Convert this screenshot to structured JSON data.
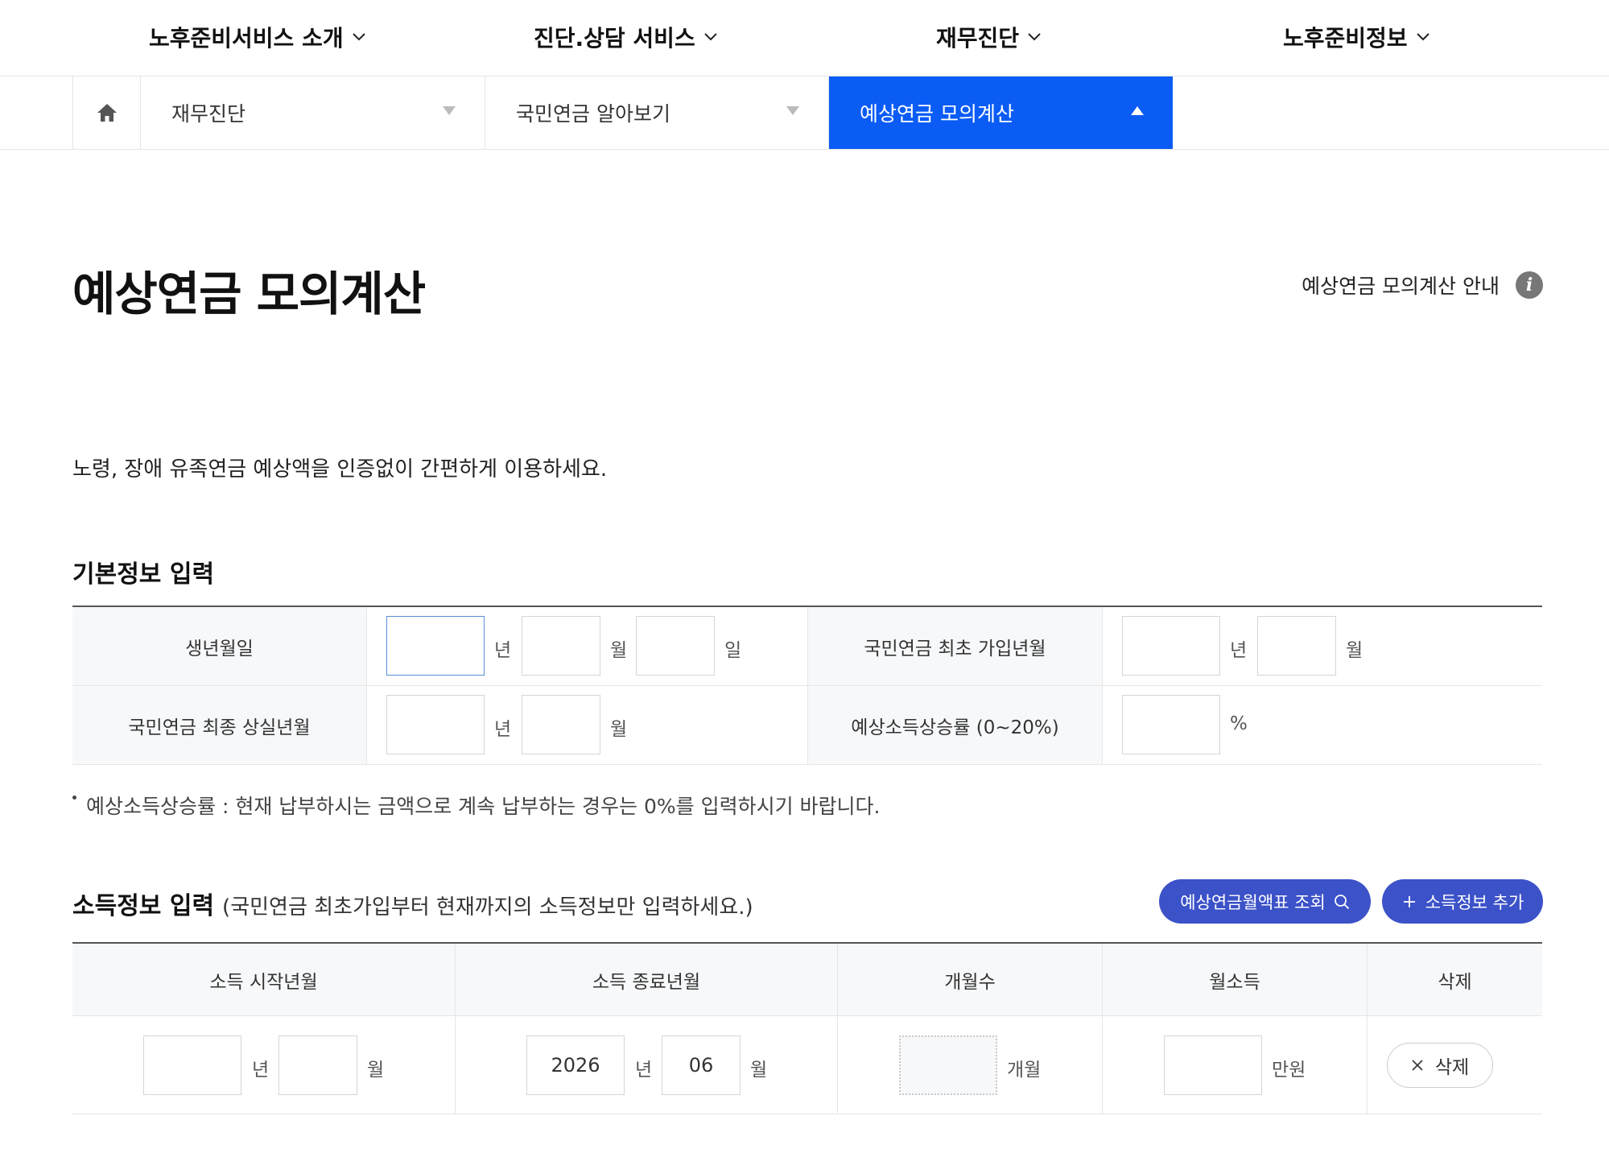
{
  "gnb": {
    "items": [
      {
        "label": "노후준비서비스 소개"
      },
      {
        "label": "진단.상담 서비스"
      },
      {
        "label": "재무진단"
      },
      {
        "label": "노후준비정보"
      }
    ]
  },
  "breadcrumb": {
    "level1": "재무진단",
    "level2": "국민연금 알아보기",
    "level3": "예상연금 모의계산"
  },
  "page": {
    "title": "예상연금 모의계산",
    "guide_link": "예상연금 모의계산 안내",
    "intro": "노령, 장애 유족연금 예상액을 인증없이 간편하게 이용하세요."
  },
  "basic_info": {
    "section_title": "기본정보 입력",
    "birth_label": "생년월일",
    "first_join_label": "국민연금 최초 가입년월",
    "last_loss_label": "국민연금 최종 상실년월",
    "growth_label": "예상소득상승률 (0~20%)",
    "unit_year": "년",
    "unit_month": "월",
    "unit_day": "일",
    "unit_percent": "%",
    "birth_year": "",
    "birth_month": "",
    "birth_day": "",
    "first_join_year": "",
    "first_join_month": "",
    "last_loss_year": "",
    "last_loss_month": "",
    "growth_rate": "",
    "note": "예상소득상승률 : 현재 납부하시는 금액으로 계속 납부하는 경우는 0%를 입력하시기 바랍니다."
  },
  "income_info": {
    "section_title": "소득정보 입력",
    "section_subtitle": "(국민연금 최초가입부터 현재까지의 소득정보만 입력하세요.)",
    "lookup_button": "예상연금월액표 조회",
    "add_button": "소득정보 추가",
    "columns": [
      "소득 시작년월",
      "소득 종료년월",
      "개월수",
      "월소득",
      "삭제"
    ],
    "unit_year": "년",
    "unit_month": "월",
    "unit_months": "개월",
    "unit_manwon": "만원",
    "rows": [
      {
        "start_year": "",
        "start_month": "",
        "end_year": "2026",
        "end_month": "06",
        "months": "",
        "income": "",
        "delete_label": "삭제"
      }
    ]
  },
  "colors": {
    "active_tab": "#0a5cf5",
    "button_blue": "#3c52c8",
    "header_bg": "#f7f8fa"
  }
}
